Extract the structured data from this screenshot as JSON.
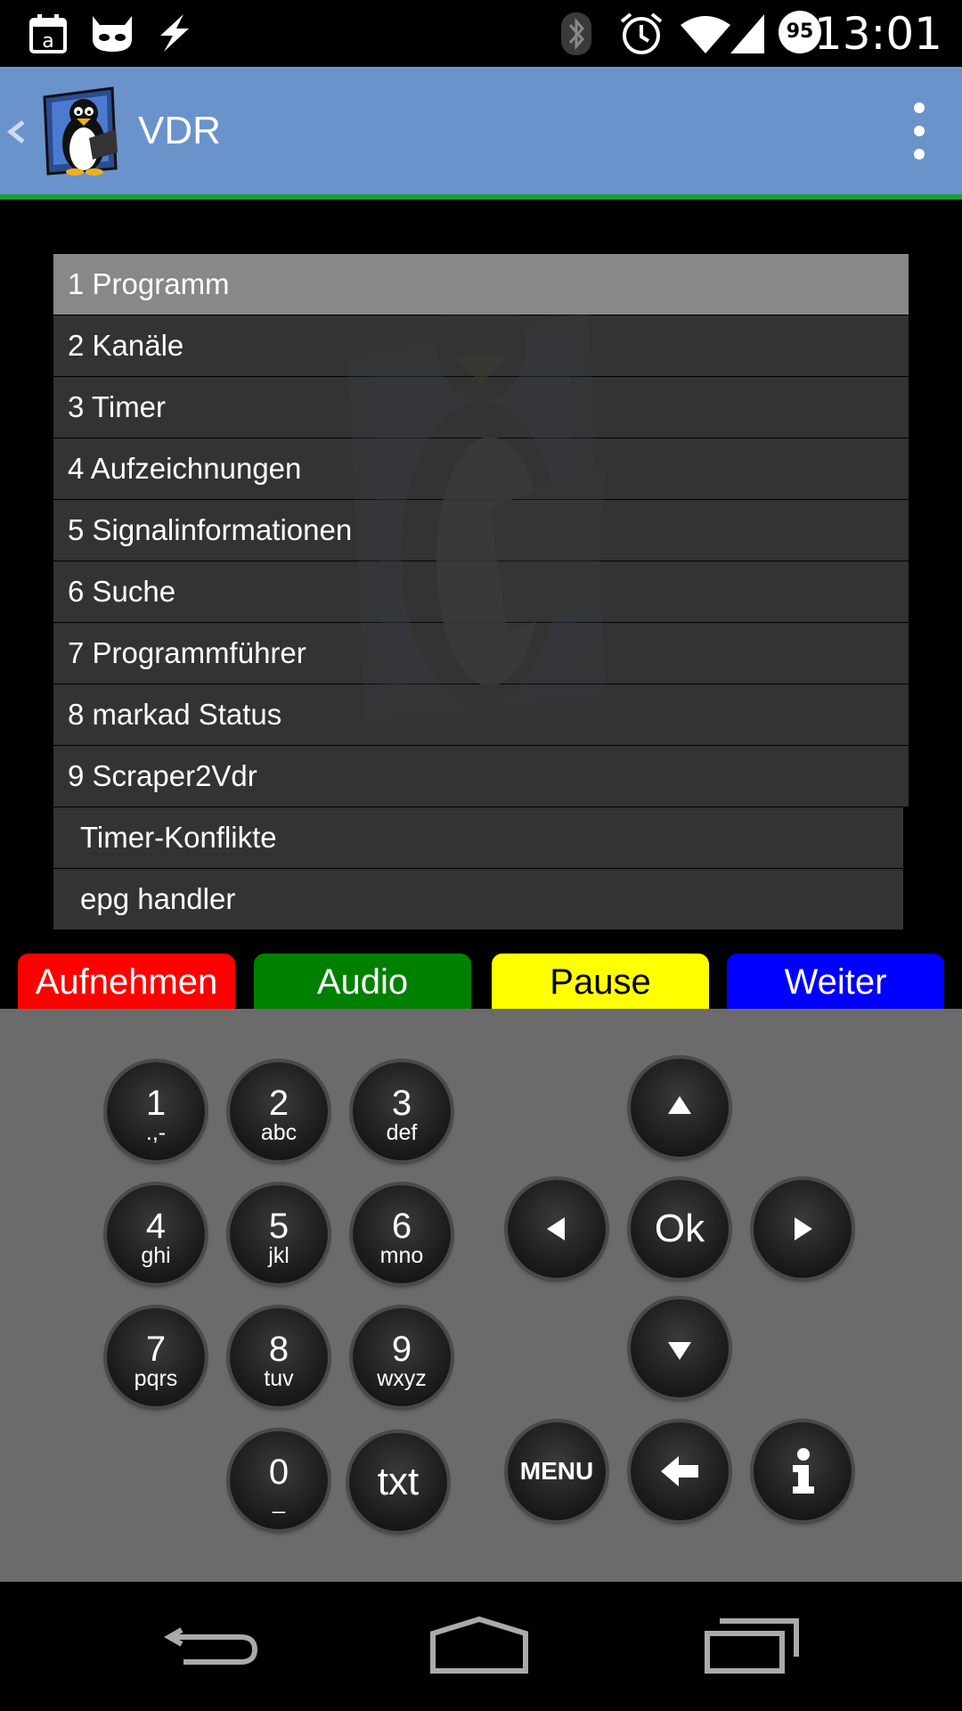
{
  "status_bar": {
    "time": "13:01",
    "battery_level": "95",
    "icons": [
      "calendar-icon",
      "cyanogen-icon",
      "flash-icon",
      "bluetooth-icon",
      "alarm-icon",
      "wifi-icon",
      "signal-icon",
      "battery-icon"
    ]
  },
  "app_bar": {
    "title": "VDR",
    "icons": [
      "up-chevron-icon",
      "tux-logo-icon",
      "overflow-menu-icon"
    ]
  },
  "menu": {
    "items": [
      {
        "label": "1 Programm",
        "selected": true
      },
      {
        "label": "2 Kanäle"
      },
      {
        "label": "3 Timer"
      },
      {
        "label": "4 Aufzeichnungen"
      },
      {
        "label": "5 Signalinformationen"
      },
      {
        "label": "6 Suche"
      },
      {
        "label": "7 Programmführer"
      },
      {
        "label": "8 markad Status"
      },
      {
        "label": "9 Scraper2Vdr"
      },
      {
        "label": "Timer-Konflikte"
      },
      {
        "label": "epg handler"
      }
    ]
  },
  "color_buttons": [
    {
      "label": "Aufnehmen",
      "color": "#ff0000",
      "text_color": "#ffffff"
    },
    {
      "label": "Audio",
      "color": "#008000",
      "text_color": "#ffffff"
    },
    {
      "label": "Pause",
      "color": "#ffff00",
      "text_color": "#000000"
    },
    {
      "label": "Weiter",
      "color": "#0000ff",
      "text_color": "#ffffff"
    }
  ],
  "keypad": {
    "digits": [
      {
        "num": "1",
        "sub": ".,-"
      },
      {
        "num": "2",
        "sub": "abc"
      },
      {
        "num": "3",
        "sub": "def"
      },
      {
        "num": "4",
        "sub": "ghi"
      },
      {
        "num": "5",
        "sub": "jkl"
      },
      {
        "num": "6",
        "sub": "mno"
      },
      {
        "num": "7",
        "sub": "pqrs"
      },
      {
        "num": "8",
        "sub": "tuv"
      },
      {
        "num": "9",
        "sub": "wxyz"
      },
      {
        "num": "0",
        "sub": "_"
      }
    ],
    "txt_label": "txt",
    "ok_label": "Ok",
    "menu_label": "MENU",
    "icons": [
      "arrow-up-icon",
      "arrow-left-icon",
      "arrow-right-icon",
      "arrow-down-icon",
      "back-arrow-icon",
      "info-icon"
    ]
  },
  "colors": {
    "app_bar": "#6a93cc",
    "app_bar_accent": "#16a03a",
    "keypad_bg": "#6b6b6b",
    "menu_selected": "#888888",
    "menu_item": "#3a3a3a"
  }
}
